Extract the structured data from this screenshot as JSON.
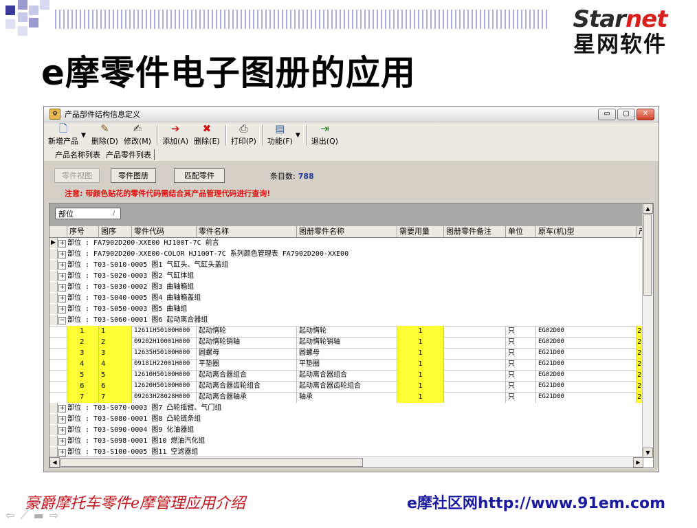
{
  "slide": {
    "title": "e摩零件电子图册的应用",
    "logo_top_a": "Star",
    "logo_top_b": "net",
    "logo_bottom": "星网软件",
    "footer_left": "豪爵摩托车零件e摩管理应用介绍",
    "footer_right": "e摩社区网http://www.91em.com",
    "nav_icons": [
      "prev-icon",
      "pen-icon",
      "menu-icon",
      "next-icon"
    ]
  },
  "window": {
    "title": "产品部件结构信息定义",
    "controls": [
      "minimize",
      "restore",
      "close"
    ],
    "toolbar": [
      {
        "label": "新增产品",
        "icon": "new-product-icon",
        "dropdown": true
      },
      {
        "label": "删除(D)",
        "icon": "delete-icon"
      },
      {
        "label": "修改(M)",
        "icon": "edit-icon"
      },
      {
        "label": "添加(A)",
        "icon": "add-icon"
      },
      {
        "label": "删除(E)",
        "icon": "delete-red-icon"
      },
      {
        "label": "打印(P)",
        "icon": "print-icon"
      },
      {
        "label": "功能(F)",
        "icon": "function-icon",
        "dropdown": true
      },
      {
        "label": "退出(Q)",
        "icon": "exit-icon"
      }
    ],
    "tabs": [
      "产品名称列表",
      "产品零件列表"
    ],
    "buttons": {
      "parts_view": "零件视图",
      "parts_catalog": "零件图册",
      "match_parts": "匹配零件"
    },
    "count_label": "条目数:",
    "count_value": "788",
    "notice": "注意: 带颜色贴花的零件代码需结合其产品管理代码进行查询!",
    "group_by": "部位",
    "columns": [
      "序号",
      "图序",
      "零件代码",
      "零件名称",
      "图册零件名称",
      "需要用量",
      "图册零件备注",
      "单位",
      "原车(机)型",
      "产"
    ],
    "group_rows_top": [
      {
        "marker": "▶",
        "text": "部位 : FA7902D200-XXE00  HJ100T-7C 前言"
      },
      {
        "text": "部位 : FA7902D200-XXE00-COLOR  HJ100T-7C 系列颜色管理表 FA7902D200-XXE00"
      },
      {
        "text": "部位 : T03-S010-0005  图1 气缸头、气缸头盖组"
      },
      {
        "text": "部位 : T03-S020-0003  图2 气缸体组"
      },
      {
        "text": "部位 : T03-S030-0002  图3 曲轴箱组"
      },
      {
        "text": "部位 : T03-S040-0005  图4 曲轴箱盖组"
      },
      {
        "text": "部位 : T03-S050-0003  图5 曲轴组"
      }
    ],
    "expanded_group": {
      "text": "部位 : T03-S060-0001  图6 起动离合器组"
    },
    "detail_rows": [
      {
        "seq": "1",
        "fig": "1",
        "code": "12611H50100H000",
        "name": "起动惰轮",
        "cat_name": "起动惰轮",
        "qty": "1",
        "note": "",
        "unit": "只",
        "model": "EG02D00",
        "extra": "2"
      },
      {
        "seq": "2",
        "fig": "2",
        "code": "09202H10001H000",
        "name": "起动惰轮销轴",
        "cat_name": "起动惰轮销轴",
        "qty": "1",
        "note": "",
        "unit": "只",
        "model": "EG02D00",
        "extra": "2"
      },
      {
        "seq": "3",
        "fig": "3",
        "code": "12635H50100H000",
        "name": "圆螺母",
        "cat_name": "圆螺母",
        "qty": "1",
        "note": "",
        "unit": "只",
        "model": "EG21D00",
        "extra": "2"
      },
      {
        "seq": "4",
        "fig": "4",
        "code": "09181H22001H000",
        "name": "平垫圈",
        "cat_name": "平垫圈",
        "qty": "1",
        "note": "",
        "unit": "只",
        "model": "EG21D00",
        "extra": "2"
      },
      {
        "seq": "5",
        "fig": "5",
        "code": "12610H50100H000",
        "name": "起动离合器组合",
        "cat_name": "起动离合器组合",
        "qty": "1",
        "note": "",
        "unit": "只",
        "model": "EG02D00",
        "extra": "2"
      },
      {
        "seq": "6",
        "fig": "6",
        "code": "12620H50100H000",
        "name": "起动离合器齿轮组合",
        "cat_name": "起动离合器齿轮组合",
        "qty": "1",
        "note": "",
        "unit": "只",
        "model": "EG21D00",
        "extra": "2"
      },
      {
        "seq": "7",
        "fig": "7",
        "code": "09263H28028H000",
        "name": "起动离合器轴承",
        "cat_name": "轴承",
        "qty": "1",
        "note": "",
        "unit": "只",
        "model": "EG21D00",
        "extra": "2"
      }
    ],
    "group_rows_bottom": [
      {
        "text": "部位 : T03-S070-0003  图7 凸轮摇臂、气门组"
      },
      {
        "text": "部位 : T03-S080-0001  图8 凸轮链条组"
      },
      {
        "text": "部位 : T03-S090-0004  图9 化油器组"
      },
      {
        "text": "部位 : T03-S098-0001  图10 燃油汽化组"
      },
      {
        "text": "部位 : T03-S100-0005  图11 空滤器组"
      }
    ]
  }
}
